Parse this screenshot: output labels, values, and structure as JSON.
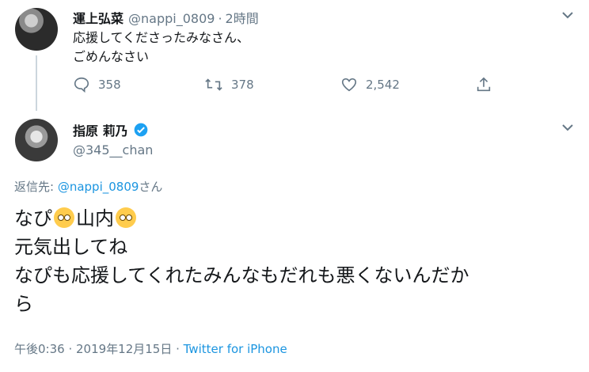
{
  "reply_tweet": {
    "display_name": "運上弘菜",
    "handle": "@nappi_0809",
    "time": "2時間",
    "text": "応援してくださったみなさん、\nごめんなさい",
    "actions": {
      "reply_count": "358",
      "retweet_count": "378",
      "like_count": "2,542"
    }
  },
  "main_tweet": {
    "display_name": "指原 莉乃",
    "handle": "@345__chan",
    "reply_to_prefix": "返信先: ",
    "reply_to_mention": "@nappi_0809",
    "reply_to_suffix": "さん",
    "text_line1_a": "なぴ",
    "text_line1_b": "山内",
    "text_line2": "元気出してね",
    "text_line3": "なぴも応援してくれたみんなもだれも悪くないんだか",
    "text_line4": "ら",
    "timestamp": "午後0:36 · 2019年12月15日 · ",
    "client": "Twitter for iPhone"
  },
  "colors": {
    "link": "#1b95e0",
    "secondary": "#657786",
    "verified": "#1da1f2",
    "emoji": "#ffcc4d"
  },
  "icons": [
    "reply-icon",
    "retweet-icon",
    "like-icon",
    "share-icon",
    "chevron-down-icon",
    "verified-badge-icon",
    "rolling-eyes-emoji"
  ]
}
